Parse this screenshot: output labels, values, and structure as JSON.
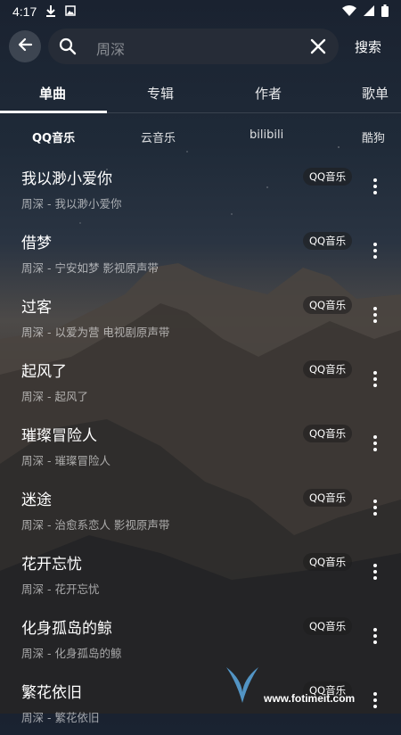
{
  "status_bar": {
    "time": "4:17"
  },
  "search": {
    "placeholder": "周深",
    "button_label": "搜索"
  },
  "tabs": [
    {
      "label": "单曲",
      "active": true
    },
    {
      "label": "专辑",
      "active": false
    },
    {
      "label": "作者",
      "active": false
    },
    {
      "label": "歌单",
      "active": false
    }
  ],
  "sources": [
    {
      "label": "QQ音乐",
      "active": true
    },
    {
      "label": "云音乐",
      "active": false
    },
    {
      "label": "bilibili",
      "active": false
    },
    {
      "label": "酷狗",
      "active": false
    }
  ],
  "songs": [
    {
      "title": "我以渺小爱你",
      "subtitle": "周深 - 我以渺小爱你",
      "badge": "QQ音乐"
    },
    {
      "title": "借梦",
      "subtitle": "周深 - 宁安如梦 影视原声带",
      "badge": "QQ音乐"
    },
    {
      "title": "过客",
      "subtitle": "周深 - 以爱为营 电视剧原声带",
      "badge": "QQ音乐"
    },
    {
      "title": "起风了",
      "subtitle": "周深 - 起风了",
      "badge": "QQ音乐"
    },
    {
      "title": "璀璨冒险人",
      "subtitle": "周深 - 璀璨冒险人",
      "badge": "QQ音乐"
    },
    {
      "title": "迷途",
      "subtitle": "周深 - 治愈系恋人 影视原声带",
      "badge": "QQ音乐"
    },
    {
      "title": "花开忘忧",
      "subtitle": "周深 - 花开忘忧",
      "badge": "QQ音乐"
    },
    {
      "title": "化身孤岛的鲸",
      "subtitle": "周深 - 化身孤岛的鲸",
      "badge": "QQ音乐"
    },
    {
      "title": "繁花依旧",
      "subtitle": "周深 - 繁花依旧",
      "badge": "QQ音乐"
    }
  ],
  "watermark": {
    "url": "www.fotimeit.com"
  }
}
